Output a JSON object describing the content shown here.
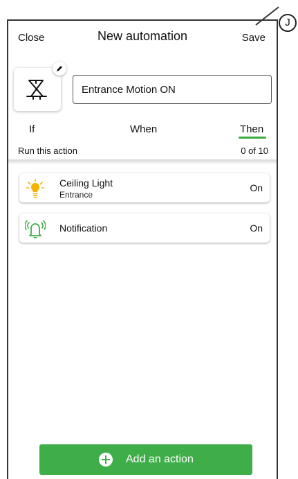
{
  "callout": {
    "label": "J"
  },
  "header": {
    "close_label": "Close",
    "title": "New automation",
    "save_label": "Save"
  },
  "automation": {
    "icon": "motion-sensor-icon",
    "edit_icon": "pencil-icon",
    "name_value": "Entrance Motion ON"
  },
  "tabs": [
    {
      "label": "If",
      "active": false
    },
    {
      "label": "When",
      "active": false
    },
    {
      "label": "Then",
      "active": true
    }
  ],
  "section": {
    "title": "Run this action",
    "count": "0 of 10"
  },
  "actions": [
    {
      "icon": "light-bulb-icon",
      "title": "Ceiling Light",
      "subtitle": "Entrance",
      "state": "On"
    },
    {
      "icon": "notification-bell-icon",
      "title": "Notification",
      "subtitle": "",
      "state": "On"
    }
  ],
  "add_button": {
    "label": "Add an action",
    "icon": "plus-circle-icon"
  },
  "colors": {
    "accent": "#3fae49",
    "bulb": "#f5b400"
  }
}
